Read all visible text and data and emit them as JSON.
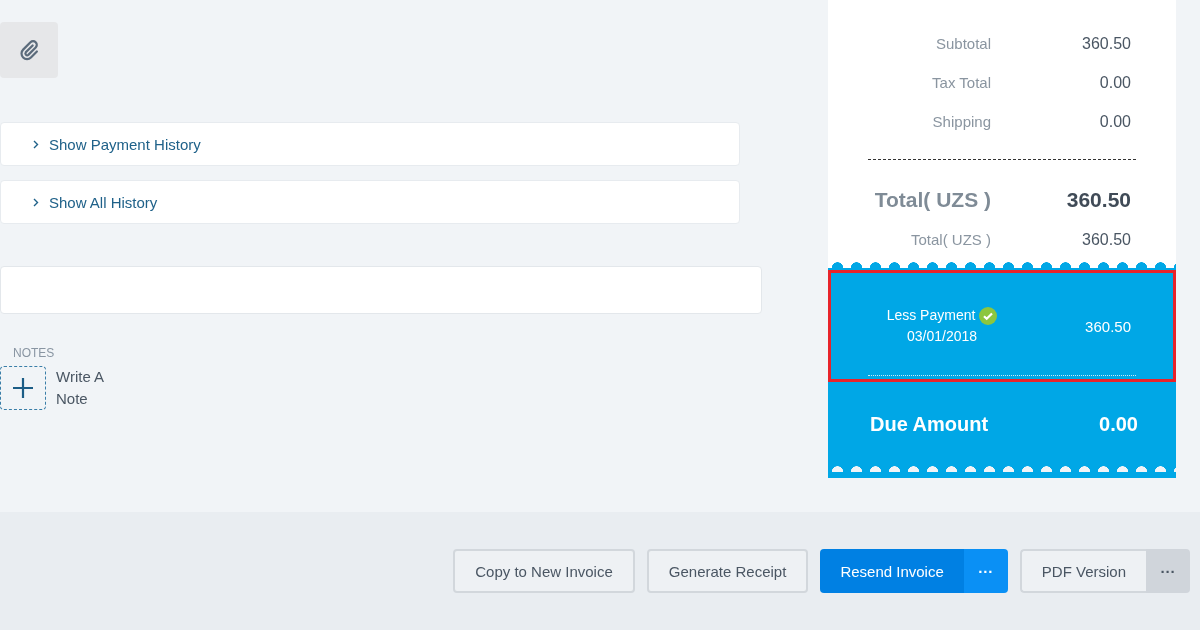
{
  "history_panels": [
    {
      "label": "Show Payment History",
      "expanded": false
    },
    {
      "label": "Show All History",
      "expanded": false
    }
  ],
  "notes": {
    "heading": "NOTES",
    "add_label": "Write A Note"
  },
  "summary": {
    "rows": [
      {
        "kind": "line",
        "label": "Subtotal",
        "value": "360.50"
      },
      {
        "kind": "line",
        "label": "Tax Total",
        "value": "0.00"
      },
      {
        "kind": "line",
        "label": "Shipping",
        "value": "0.00"
      },
      {
        "kind": "divider"
      },
      {
        "kind": "total",
        "label": "Total( UZS )",
        "value": "360.50"
      },
      {
        "kind": "line",
        "label": "Total( UZS )",
        "value": "360.50"
      }
    ],
    "payment": {
      "label": "Less Payment",
      "date": "03/01/2018",
      "value": "360.50",
      "verified": true,
      "highlighted": true
    },
    "due": {
      "label": "Due Amount",
      "value": "0.00"
    }
  },
  "actions": [
    {
      "kind": "plain",
      "label": "Copy to New Invoice"
    },
    {
      "kind": "plain",
      "label": "Generate Receipt"
    },
    {
      "kind": "primary",
      "label": "Resend Invoice",
      "more": "···"
    },
    {
      "kind": "plain",
      "label": "PDF Version",
      "more": "···"
    }
  ]
}
